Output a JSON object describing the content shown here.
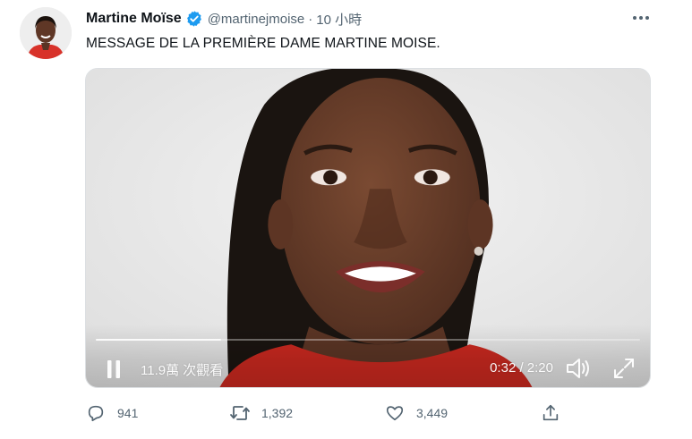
{
  "tweet": {
    "display_name": "Martine Moïse",
    "verified_icon": "verified-badge-icon",
    "handle": "@martinejmoise",
    "separator": "·",
    "time": "10 小時",
    "text": "MESSAGE DE LA PREMIÈRE DAME MARTINE MOISE."
  },
  "video": {
    "views_label": "11.9萬 次觀看",
    "time_label": "0:32 / 2:20",
    "progress_fraction": 0.23,
    "icons": [
      "pause-icon",
      "volume-icon",
      "fullscreen-icon"
    ]
  },
  "actions": {
    "reply_count": "941",
    "retweet_count": "1,392",
    "like_count": "3,449",
    "icons": [
      "reply-icon",
      "retweet-icon",
      "like-icon",
      "share-icon"
    ]
  },
  "colors": {
    "verified": "#1d9bf0",
    "text_primary": "#0f1419",
    "text_secondary": "#536471"
  }
}
